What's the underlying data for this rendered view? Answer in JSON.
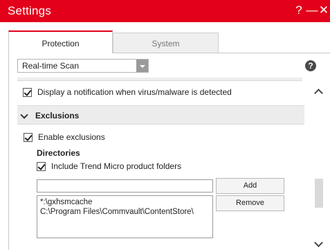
{
  "window": {
    "title": "Settings",
    "help_glyph": "?",
    "minimize_glyph": "—",
    "close_glyph": "✕",
    "accent_color": "#e2001a"
  },
  "tabs": [
    {
      "label": "Protection",
      "active": true
    },
    {
      "label": "System",
      "active": false
    }
  ],
  "scan_mode": {
    "selected": "Real-time Scan"
  },
  "help_icon": "?",
  "notification": {
    "label": "Display a notification when virus/malware is detected",
    "checked": true
  },
  "exclusions": {
    "header": "Exclusions",
    "enable_label": "Enable exclusions",
    "enable_checked": true,
    "directories_label": "Directories",
    "include_trend_label": "Include Trend Micro product folders",
    "include_trend_checked": true,
    "input_value": "",
    "add_label": "Add",
    "remove_label": "Remove",
    "directory_list": [
      "*:\\gxhsmcache",
      "C:\\Program Files\\Commvault\\ContentStore\\"
    ]
  }
}
